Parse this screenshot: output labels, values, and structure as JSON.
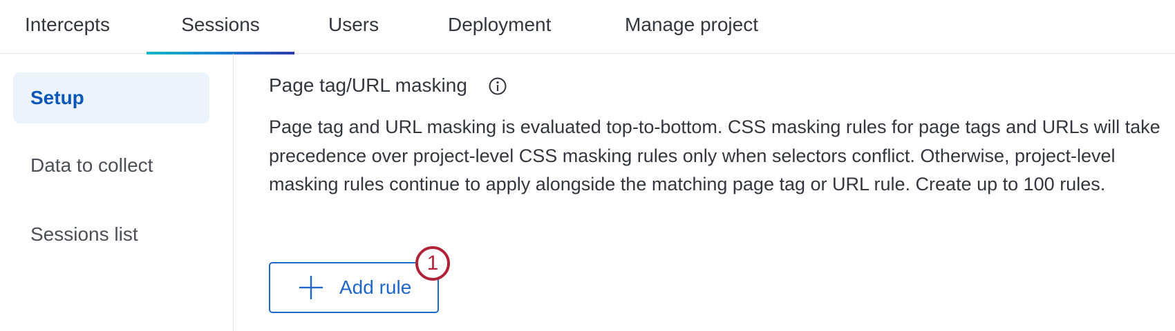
{
  "top_tabs": [
    {
      "label": "Intercepts"
    },
    {
      "label": "Sessions",
      "active": true
    },
    {
      "label": "Users"
    },
    {
      "label": "Deployment"
    },
    {
      "label": "Manage project"
    }
  ],
  "sidebar": {
    "items": [
      {
        "label": "Setup",
        "active": true
      },
      {
        "label": "Data to collect"
      },
      {
        "label": "Sessions list"
      }
    ]
  },
  "section": {
    "title": "Page tag/URL masking",
    "info_icon": "info-icon",
    "description": "Page tag and URL masking is evaluated top-to-bottom. CSS masking rules for page tags and URLs will take precedence over project-level CSS masking rules only when selectors conflict. Otherwise, project-level masking rules continue to apply alongside the matching page tag or URL rule. Create up to 100 rules."
  },
  "add_rule_button": {
    "label": "Add rule",
    "icon": "plus-icon"
  },
  "step_badge": {
    "number": "1"
  },
  "colors": {
    "accent": "#1f67c8",
    "sidebar_active_bg": "#edf3fb",
    "sidebar_active_text": "#0b57b8",
    "badge": "#b0243a"
  }
}
